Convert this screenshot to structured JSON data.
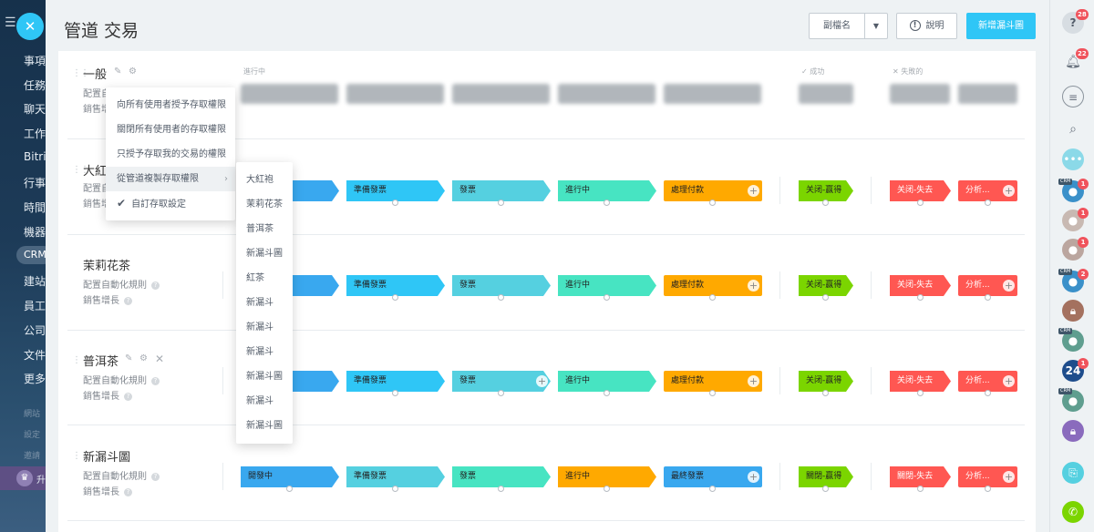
{
  "header": {
    "title": "管道 交易",
    "alias_button": "副檔名",
    "help_button": "說明",
    "new_funnel_button": "新增漏斗圖"
  },
  "leftnav": {
    "items": [
      "事項",
      "任務",
      "聊天",
      "工作",
      "Bitrix",
      "行事",
      "時間",
      "機器",
      "CRM",
      "建站",
      "員工",
      "公司",
      "文件",
      "更多"
    ],
    "dim_items": [
      "網站",
      "設定",
      "邀請"
    ],
    "bottom_text": "升"
  },
  "columns": {
    "in_progress": "進行中",
    "success": "✓ 成功",
    "failed": "✕ 失敗的"
  },
  "pipelines": [
    {
      "name": "一般",
      "link1": "配置自動化規則",
      "link2": "銷售增長",
      "stages": []
    },
    {
      "name": "大紅袍",
      "link1": "配置自動化規則",
      "link2": "銷售增長",
      "stages": [
        "",
        "準備發票",
        "發票",
        "進行中",
        "處理付款"
      ],
      "won": "关闭-赢得",
      "lost": [
        "关闭-失去",
        "分析..."
      ]
    },
    {
      "name": "茉莉花茶",
      "link1": "配置自動化規則",
      "link2": "銷售增長",
      "stages": [
        "",
        "準備發票",
        "發票",
        "進行中",
        "處理付款"
      ],
      "won": "关闭-赢得",
      "lost": [
        "关闭-失去",
        "分析..."
      ]
    },
    {
      "name": "普洱茶",
      "link1": "配置自動化規則",
      "link2": "銷售增長",
      "stages": [
        "",
        "準備發票",
        "發票",
        "進行中",
        "處理付款"
      ],
      "won": "关闭-赢得",
      "lost": [
        "关闭-失去",
        "分析..."
      ]
    },
    {
      "name": "新漏斗圖",
      "link1": "配置自動化規則",
      "link2": "銷售增長",
      "stages": [
        "開發中",
        "準備發票",
        "發票",
        "進行中",
        "最終發票"
      ],
      "won": "關閉-贏得",
      "lost": [
        "關閉-失去",
        "分析..."
      ]
    }
  ],
  "menu": {
    "items": [
      "向所有使用者授予存取權限",
      "關閉所有使用者的存取權限",
      "只授予存取我的交易的權限",
      "從管道複製存取權限",
      "自訂存取設定"
    ]
  },
  "submenu": {
    "items": [
      "大紅袍",
      "茉莉花茶",
      "普洱茶",
      "新漏斗圖",
      "紅茶",
      "新漏斗",
      "新漏斗",
      "新漏斗",
      "新漏斗圖",
      "新漏斗",
      "新漏斗圖"
    ]
  },
  "rightbar": {
    "badges": {
      "help": "28",
      "bell": "22",
      "crm1": "1",
      "crm2": "1",
      "crm3": "1",
      "crm4": "2",
      "cal24": "1"
    },
    "crm_tag": "CRM",
    "calendar_text": "24"
  },
  "colors": {
    "stage_blue": "#39a8ef",
    "stage_cyan": "#2fc6f6",
    "stage_teal": "#55d0e0",
    "stage_green": "#47e4c2",
    "stage_orange": "#ffa900",
    "won": "#7bd500",
    "lost": "#ff5752"
  }
}
